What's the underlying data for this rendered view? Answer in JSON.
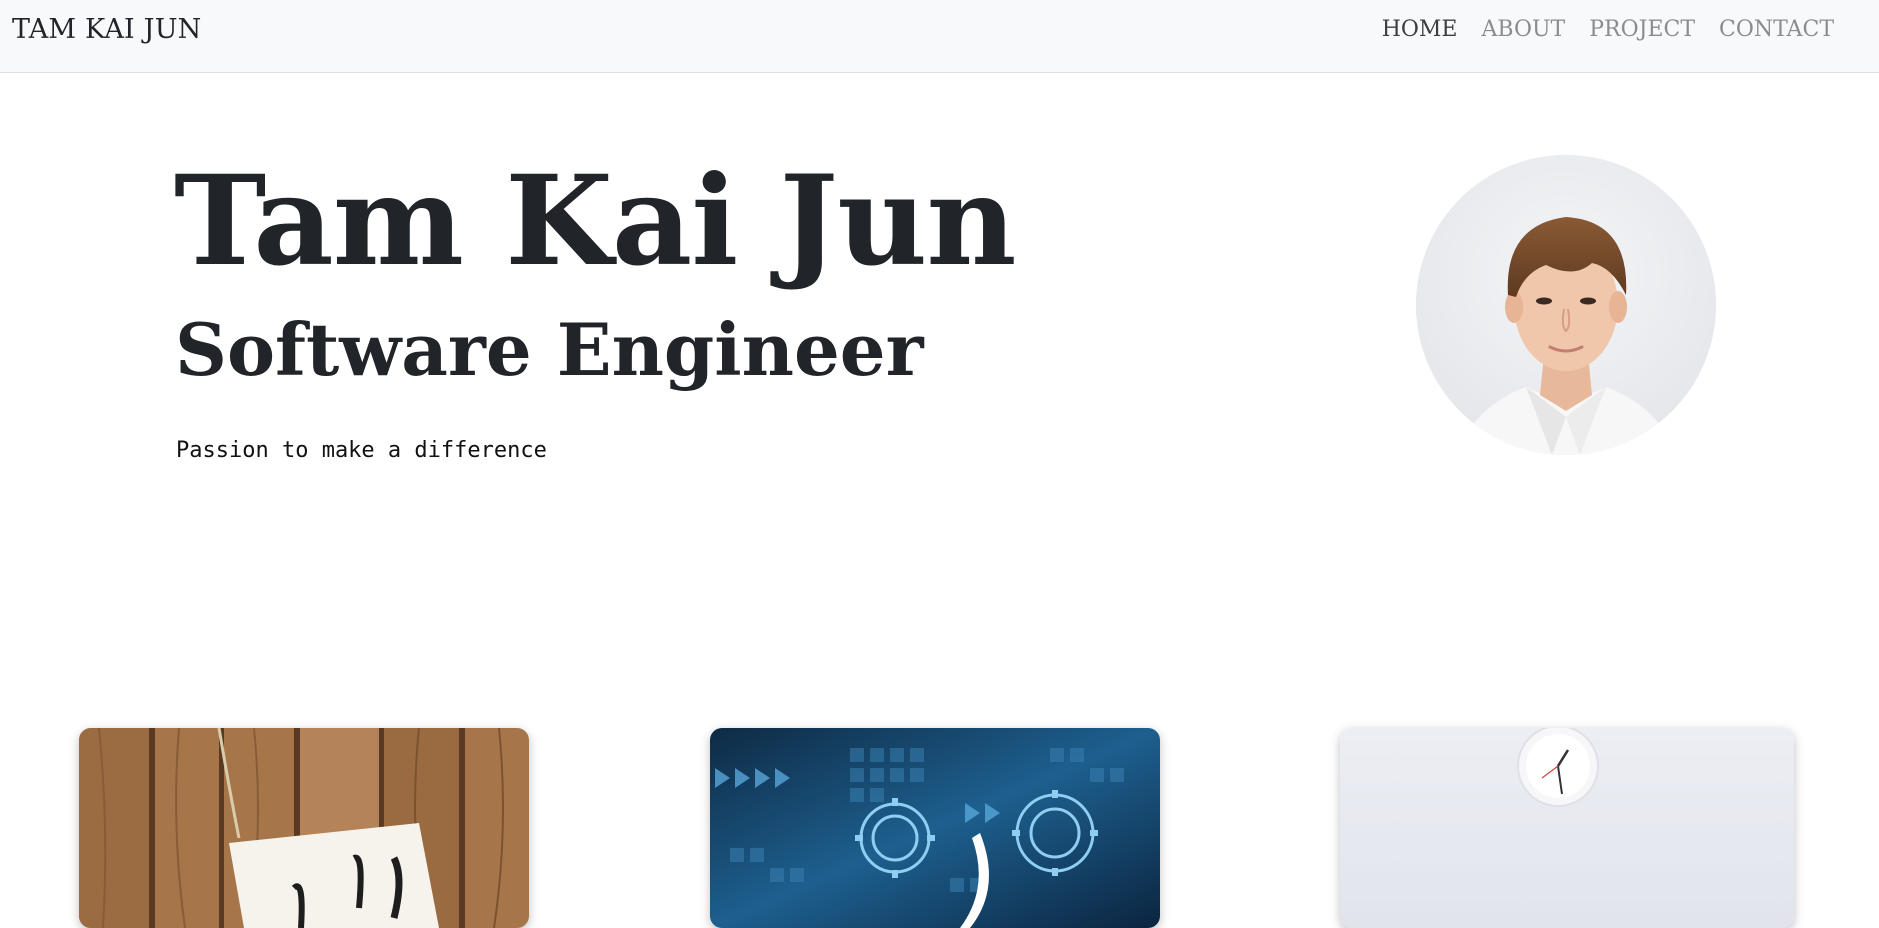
{
  "navbar": {
    "brand": "TAM KAI JUN",
    "items": [
      {
        "label": "HOME",
        "active": true
      },
      {
        "label": "ABOUT",
        "active": false
      },
      {
        "label": "PROJECT",
        "active": false
      },
      {
        "label": "CONTACT",
        "active": false
      }
    ]
  },
  "hero": {
    "name": "Tam Kai Jun",
    "role": "Software Engineer",
    "tagline": "Passion to make a difference"
  },
  "cards": [
    {
      "image": "wooden-board-with-note-image"
    },
    {
      "image": "blue-technology-gears-image"
    },
    {
      "image": "white-wall-clock-image"
    }
  ],
  "colors": {
    "navbar_bg": "#f8f9fa",
    "nav_inactive": "#8a8c8e",
    "nav_active": "#3b3f43",
    "text": "#212529"
  }
}
